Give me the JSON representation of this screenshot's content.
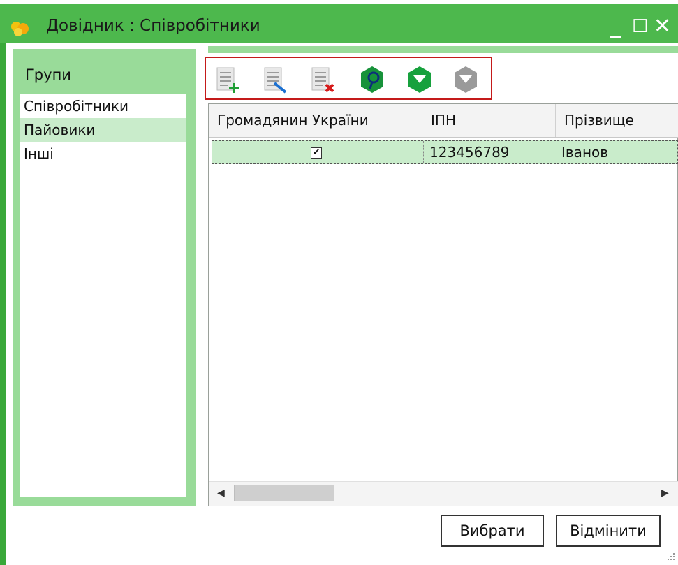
{
  "window": {
    "title": "Довідник : Співробітники",
    "minimize": "_",
    "maximize": "☐",
    "close": "✕",
    "accent": "#4db84d"
  },
  "groups": {
    "header": "Групи",
    "items": [
      {
        "label": "Співробітники",
        "selected": false
      },
      {
        "label": "Пайовики",
        "selected": true
      },
      {
        "label": "Інші",
        "selected": false
      }
    ]
  },
  "toolbar": {
    "buttons": [
      {
        "icon": "add-record-icon"
      },
      {
        "icon": "edit-record-icon"
      },
      {
        "icon": "delete-record-icon"
      },
      {
        "icon": "search-icon"
      },
      {
        "icon": "filter-icon"
      },
      {
        "icon": "filter-disabled-icon"
      }
    ]
  },
  "grid": {
    "columns": [
      "Громадянин України",
      "ІПН",
      "Прізвище"
    ],
    "rows": [
      {
        "citizen": true,
        "citizen_mark": "✔",
        "ipn": "123456789",
        "surname": "Іванов"
      }
    ]
  },
  "scrollbar": {
    "left": "◀",
    "right": "▶"
  },
  "actions": {
    "select": "Вибрати",
    "cancel": "Відмінити"
  }
}
